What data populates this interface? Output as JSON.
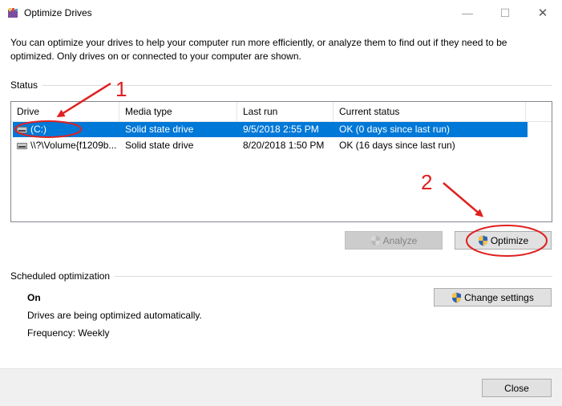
{
  "window": {
    "title": "Optimize Drives",
    "close_glyph": "✕",
    "minimize_glyph": "—",
    "maximize_glyph": "☐"
  },
  "intro_text": "You can optimize your drives to help your computer run more efficiently, or analyze them to find out if they need to be optimized. Only drives on or connected to your computer are shown.",
  "status": {
    "label": "Status",
    "columns": [
      "Drive",
      "Media type",
      "Last run",
      "Current status"
    ],
    "rows": [
      {
        "drive": "(C:)",
        "media_type": "Solid state drive",
        "last_run": "9/5/2018 2:55 PM",
        "current_status": "OK (0 days since last run)",
        "selected": true
      },
      {
        "drive": "\\\\?\\Volume{f1209b...",
        "media_type": "Solid state drive",
        "last_run": "8/20/2018 1:50 PM",
        "current_status": "OK (16 days since last run)",
        "selected": false
      }
    ]
  },
  "buttons": {
    "analyze": "Analyze",
    "optimize": "Optimize",
    "change_settings": "Change settings",
    "close": "Close"
  },
  "scheduled": {
    "label": "Scheduled optimization",
    "state": "On",
    "description": "Drives are being optimized automatically.",
    "frequency": "Frequency: Weekly"
  },
  "annotations": {
    "step1": "1",
    "step2": "2",
    "color": "#e02020"
  },
  "colors": {
    "selection": "#0078d7",
    "footer": "#f0f0f0"
  }
}
